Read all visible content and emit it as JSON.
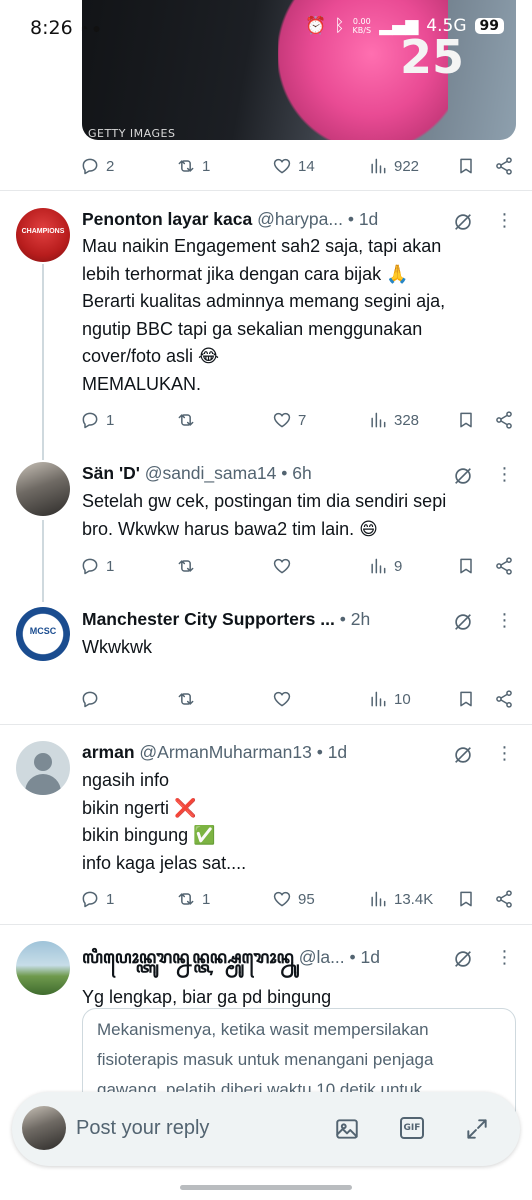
{
  "status_bar": {
    "time": "8:26",
    "network_speed_top": "0.00",
    "network_speed_unit": "KB/S",
    "network_type": "4.5G",
    "battery": "99"
  },
  "media": {
    "credit": "GETTY IMAGES",
    "jersey_number": "25"
  },
  "main_tweet_actions": {
    "replies": "2",
    "reposts": "1",
    "likes": "14",
    "views": "922"
  },
  "replies": [
    {
      "name": "Penonton layar kaca",
      "handle": "@harypa...",
      "time": "1d",
      "text": "Mau naikin Engagement sah2 saja, tapi akan\nlebih terhormat jika dengan cara bijak 🙏\nBerarti kualitas adminnya memang segini aja,\nngutip BBC tapi ga sekalian menggunakan\ncover/foto asli 😂\nMEMALUKAN.",
      "replies": "1",
      "reposts": "",
      "likes": "7",
      "views": "328",
      "avatar_text": "CHAMPIONS"
    },
    {
      "name": "Sän 'D'",
      "handle": "@sandi_sama14",
      "time": "6h",
      "text": "Setelah gw cek, postingan tim dia sendiri sepi\nbro. Wkwkw harus bawa2 tim lain. 😄",
      "replies": "1",
      "reposts": "",
      "likes": "",
      "views": "9"
    },
    {
      "name": "Manchester City Supporters ...",
      "handle": "",
      "time": "2h",
      "text": "Wkwkwk",
      "replies": "",
      "reposts": "",
      "likes": "",
      "views": "10",
      "avatar_text": "MCSC"
    },
    {
      "name": "arman",
      "handle": "@ArmanMuharman13",
      "time": "1d",
      "text": "ngasih info\nbikin ngerti ❌\nbikin bingung ✅\ninfo kaga jelas sat....",
      "replies": "1",
      "reposts": "1",
      "likes": "95",
      "views": "13.4K"
    },
    {
      "name": "ꦭꦶꦥꦺꦴꦤ꧀ꦠꦸꦫꦤ꧀ꦤꦤ꧀ꦠꦤ꧀ꦱ꧀ꦩꦸꦫꦺꦴꦤ꧀ꦤꦸ",
      "handle": "@la...",
      "time": "1d",
      "text": "Yg lengkap, biar ga pd bingung",
      "quote_text": "Mekanismenya, ketika wasit mempersilakan\nfisioterapis masuk untuk menangani penjaga\ngawang, pelatih diberi waktu 10 detik untuk"
    }
  ],
  "reply_bar": {
    "placeholder": "Post your reply"
  },
  "colors": {
    "text_primary": "#0f1419",
    "text_secondary": "#536471",
    "divider": "#e6e8ea"
  }
}
